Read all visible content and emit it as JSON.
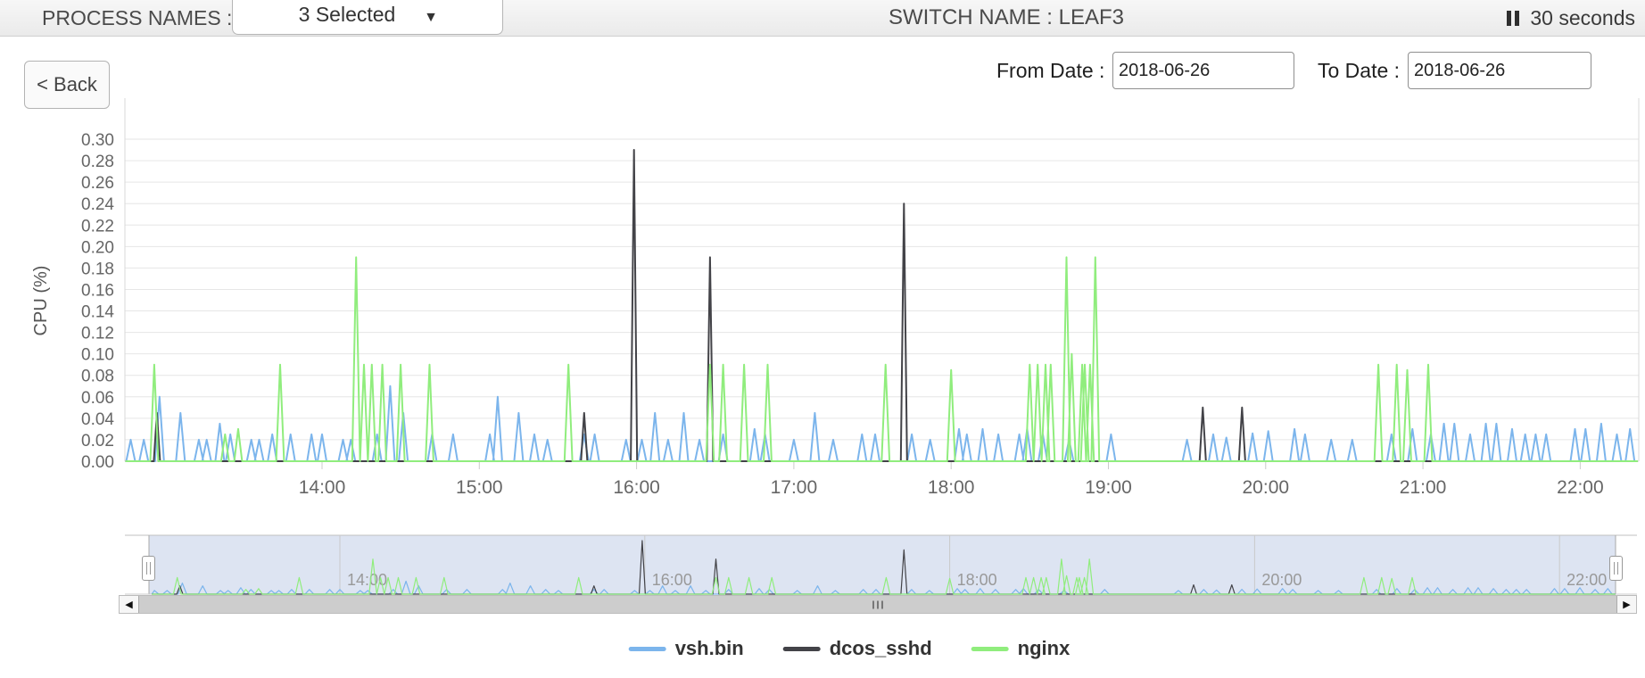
{
  "header": {
    "process_names_label": "PROCESS NAMES :",
    "process_dropdown_value": "3 Selected",
    "caret_glyph": "▼",
    "switch_label": "SWITCH NAME : LEAF3",
    "refresh_interval": "30 seconds"
  },
  "toolbar": {
    "back_label": "< Back",
    "from_label": "From Date :",
    "from_value": "2018-06-26",
    "to_label": "To Date :",
    "to_value": "2018-06-26"
  },
  "scrollbar": {
    "left_arrow": "◀",
    "right_arrow": "▶"
  },
  "legend": [
    {
      "label": "vsh.bin",
      "color": "#7cb5ec"
    },
    {
      "label": "dcos_sshd",
      "color": "#434348"
    },
    {
      "label": "nginx",
      "color": "#90ed7d"
    }
  ],
  "chart_data": {
    "type": "line",
    "title": "",
    "xlabel": "",
    "ylabel": "CPU (%)",
    "ylim": [
      0,
      0.3
    ],
    "yticks": [
      "0.00",
      "0.02",
      "0.04",
      "0.06",
      "0.08",
      "0.10",
      "0.12",
      "0.14",
      "0.16",
      "0.18",
      "0.20",
      "0.22",
      "0.24",
      "0.26",
      "0.28",
      "0.30"
    ],
    "xticks": [
      "14:00",
      "15:00",
      "16:00",
      "17:00",
      "18:00",
      "19:00",
      "20:00",
      "21:00",
      "22:00"
    ],
    "time_range": [
      "12:45",
      "22:22"
    ],
    "grid": "horizontal-only",
    "legend_position": "bottom",
    "series": [
      {
        "name": "vsh.bin",
        "color": "#7cb5ec",
        "spike_halfwidth_min": 1.7,
        "baseline": 0,
        "spikes": [
          [
            "12:47",
            0.02
          ],
          [
            "12:52",
            0.02
          ],
          [
            "12:58",
            0.06
          ],
          [
            "13:06",
            0.045
          ],
          [
            "13:13",
            0.02
          ],
          [
            "13:16",
            0.02
          ],
          [
            "13:21",
            0.035
          ],
          [
            "13:25",
            0.025
          ],
          [
            "13:33",
            0.02
          ],
          [
            "13:36",
            0.02
          ],
          [
            "13:41",
            0.025
          ],
          [
            "13:48",
            0.025
          ],
          [
            "13:56",
            0.025
          ],
          [
            "14:00",
            0.025
          ],
          [
            "14:08",
            0.02
          ],
          [
            "14:11",
            0.02
          ],
          [
            "14:21",
            0.025
          ],
          [
            "14:26",
            0.07
          ],
          [
            "14:31",
            0.045
          ],
          [
            "14:42",
            0.025
          ],
          [
            "14:50",
            0.025
          ],
          [
            "15:04",
            0.025
          ],
          [
            "15:07",
            0.06
          ],
          [
            "15:15",
            0.045
          ],
          [
            "15:21",
            0.025
          ],
          [
            "15:26",
            0.02
          ],
          [
            "15:40",
            0.025
          ],
          [
            "15:44",
            0.025
          ],
          [
            "15:56",
            0.02
          ],
          [
            "16:02",
            0.02
          ],
          [
            "16:07",
            0.045
          ],
          [
            "16:12",
            0.02
          ],
          [
            "16:18",
            0.045
          ],
          [
            "16:24",
            0.02
          ],
          [
            "16:33",
            0.025
          ],
          [
            "16:45",
            0.03
          ],
          [
            "16:49",
            0.025
          ],
          [
            "17:00",
            0.02
          ],
          [
            "17:08",
            0.045
          ],
          [
            "17:15",
            0.02
          ],
          [
            "17:26",
            0.025
          ],
          [
            "17:31",
            0.025
          ],
          [
            "17:45",
            0.025
          ],
          [
            "17:52",
            0.02
          ],
          [
            "18:03",
            0.03
          ],
          [
            "18:06",
            0.025
          ],
          [
            "18:12",
            0.03
          ],
          [
            "18:18",
            0.025
          ],
          [
            "18:26",
            0.025
          ],
          [
            "18:29",
            0.03
          ],
          [
            "18:35",
            0.025
          ],
          [
            "18:45",
            0.02
          ],
          [
            "19:01",
            0.025
          ],
          [
            "19:30",
            0.02
          ],
          [
            "19:40",
            0.025
          ],
          [
            "19:45",
            0.022
          ],
          [
            "19:55",
            0.026
          ],
          [
            "20:01",
            0.028
          ],
          [
            "20:11",
            0.03
          ],
          [
            "20:15",
            0.025
          ],
          [
            "20:25",
            0.02
          ],
          [
            "20:33",
            0.02
          ],
          [
            "20:48",
            0.025
          ],
          [
            "20:56",
            0.03
          ],
          [
            "21:03",
            0.025
          ],
          [
            "21:08",
            0.035
          ],
          [
            "21:12",
            0.035
          ],
          [
            "21:18",
            0.025
          ],
          [
            "21:24",
            0.035
          ],
          [
            "21:28",
            0.035
          ],
          [
            "21:34",
            0.03
          ],
          [
            "21:39",
            0.025
          ],
          [
            "21:43",
            0.025
          ],
          [
            "21:47",
            0.025
          ],
          [
            "21:58",
            0.03
          ],
          [
            "22:02",
            0.03
          ],
          [
            "22:08",
            0.035
          ],
          [
            "22:14",
            0.025
          ],
          [
            "22:19",
            0.03
          ]
        ]
      },
      {
        "name": "dcos_sshd",
        "color": "#434348",
        "spike_halfwidth_min": 1.2,
        "baseline": 0,
        "spikes": [
          [
            "12:57",
            0.045
          ],
          [
            "15:40",
            0.045
          ],
          [
            "15:59",
            0.29
          ],
          [
            "16:28",
            0.19
          ],
          [
            "17:42",
            0.24
          ],
          [
            "19:36",
            0.05
          ],
          [
            "19:51",
            0.05
          ]
        ]
      },
      {
        "name": "nginx",
        "color": "#90ed7d",
        "spike_halfwidth_min": 1.5,
        "baseline": 0,
        "spikes": [
          [
            "12:56",
            0.09
          ],
          [
            "13:23",
            0.025
          ],
          [
            "13:28",
            0.03
          ],
          [
            "13:44",
            0.09
          ],
          [
            "14:13",
            0.19
          ],
          [
            "14:16",
            0.09
          ],
          [
            "14:19",
            0.09
          ],
          [
            "14:23",
            0.09
          ],
          [
            "14:30",
            0.09
          ],
          [
            "14:41",
            0.09
          ],
          [
            "15:34",
            0.09
          ],
          [
            "16:28",
            0.09
          ],
          [
            "16:33",
            0.09
          ],
          [
            "16:41",
            0.09
          ],
          [
            "16:50",
            0.09
          ],
          [
            "17:35",
            0.09
          ],
          [
            "18:00",
            0.085
          ],
          [
            "18:30",
            0.09
          ],
          [
            "18:33",
            0.09
          ],
          [
            "18:36",
            0.09
          ],
          [
            "18:38",
            0.09
          ],
          [
            "18:44",
            0.19
          ],
          [
            "18:46",
            0.1
          ],
          [
            "18:50",
            0.09
          ],
          [
            "18:51",
            0.09
          ],
          [
            "18:53",
            0.09
          ],
          [
            "18:55",
            0.19
          ],
          [
            "20:43",
            0.09
          ],
          [
            "20:50",
            0.09
          ],
          [
            "20:54",
            0.085
          ],
          [
            "21:02",
            0.09
          ]
        ]
      }
    ],
    "navigator": {
      "xticks": [
        "14:00",
        "16:00",
        "18:00",
        "20:00",
        "22:00"
      ],
      "range": [
        "12:46",
        "22:22"
      ],
      "mask_color": "rgba(102,133,194,0.22)"
    }
  }
}
